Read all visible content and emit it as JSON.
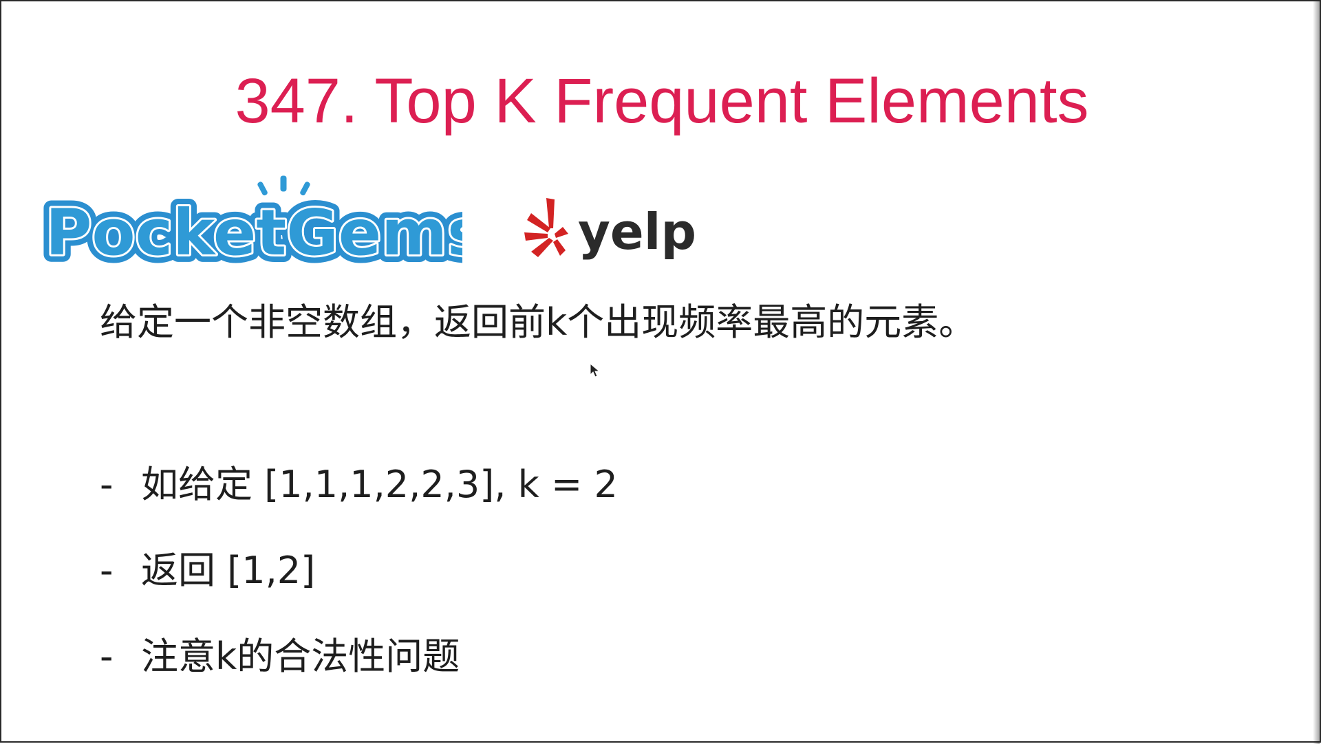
{
  "slide": {
    "title": "347. Top K Frequent Elements",
    "title_color": "#dc1f52",
    "description": "给定一个非空数组，返回前k个出现频率最高的元素。",
    "bullets": [
      {
        "marker": "-",
        "text": "如给定 [1,1,1,2,2,3], k = 2"
      },
      {
        "marker": "-",
        "text": "返回 [1,2]"
      },
      {
        "marker": "-",
        "text": "注意k的合法性问题"
      }
    ]
  },
  "logos": {
    "pocketgems": {
      "text": "PocketGems",
      "icon": "pocketgems-logo"
    },
    "yelp": {
      "text": "yelp",
      "icon": "yelp-logo"
    }
  },
  "cursor": {
    "icon": "mouse-pointer-icon"
  }
}
